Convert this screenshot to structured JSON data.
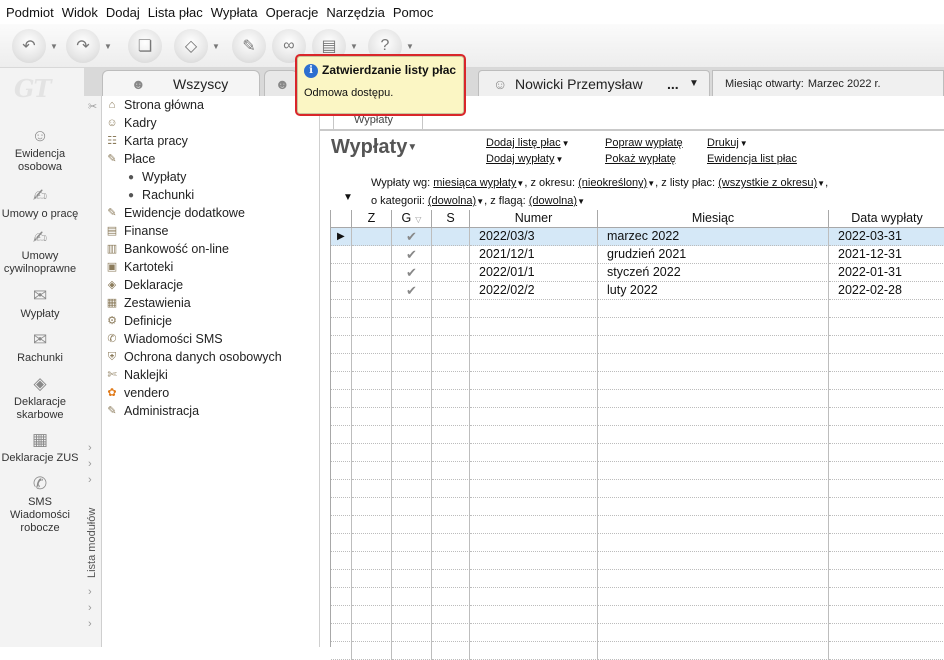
{
  "menu": [
    "Podmiot",
    "Widok",
    "Dodaj",
    "Lista płac",
    "Wypłata",
    "Operacje",
    "Narzędzia",
    "Pomoc"
  ],
  "toolbar": {
    "icons": [
      "back-icon",
      "forward-icon",
      "pages-icon",
      "eraser-icon",
      "tools-icon",
      "link-icon",
      "print-icon",
      "help-icon"
    ]
  },
  "logo": "GT",
  "modules": [
    {
      "label": "Ewidencja osobowa",
      "icon": "people-icon"
    },
    {
      "label": "Umowy o pracę",
      "icon": "contract-icon"
    },
    {
      "label": "Umowy cywilnoprawne",
      "icon": "civil-contract-icon"
    },
    {
      "label": "Wypłaty",
      "icon": "payouts-icon"
    },
    {
      "label": "Rachunki",
      "icon": "bills-icon"
    },
    {
      "label": "Deklaracje skarbowe",
      "icon": "tax-declaration-icon"
    },
    {
      "label": "Deklaracje ZUS",
      "icon": "zus-icon"
    },
    {
      "label": "SMS Wiadomości robocze",
      "icon": "sms-icon"
    }
  ],
  "modules_label": "Lista modułów",
  "tabs": {
    "all": "Wszyscy",
    "user": "Nowicki Przemysław",
    "user_more": "...",
    "month_label": "Miesiąc otwarty:",
    "month_value": "Marzec 2022 r."
  },
  "nav": [
    {
      "label": "Strona główna",
      "icon": "home-icon"
    },
    {
      "label": "Kadry",
      "icon": "staff-icon"
    },
    {
      "label": "Karta pracy",
      "icon": "workcard-icon"
    },
    {
      "label": "Płace",
      "icon": "payroll-icon"
    },
    {
      "label": "Ewidencje dodatkowe",
      "icon": "records-icon"
    },
    {
      "label": "Finanse",
      "icon": "finance-icon"
    },
    {
      "label": "Bankowość on-line",
      "icon": "bank-icon"
    },
    {
      "label": "Kartoteki",
      "icon": "files-icon"
    },
    {
      "label": "Deklaracje",
      "icon": "declaration-icon"
    },
    {
      "label": "Zestawienia",
      "icon": "report-icon"
    },
    {
      "label": "Definicje",
      "icon": "definition-icon"
    },
    {
      "label": "Wiadomości SMS",
      "icon": "sms-icon"
    },
    {
      "label": "Ochrona danych osobowych",
      "icon": "shield-icon"
    },
    {
      "label": "Naklejki",
      "icon": "sticker-icon"
    },
    {
      "label": "vendero",
      "icon": "vendero-icon"
    },
    {
      "label": "Administracja",
      "icon": "admin-icon"
    }
  ],
  "nav_sub": [
    "Wypłaty",
    "Rachunki"
  ],
  "content": {
    "tab_label": "Wypłaty",
    "heading": "Wypłaty",
    "actions": {
      "add_list": "Dodaj listę płac",
      "add_payout": "Dodaj wypłaty",
      "fix_payout": "Popraw wypłatę",
      "show_payout": "Pokaż wypłatę",
      "print": "Drukuj",
      "payroll_register": "Ewidencja list płac"
    },
    "filters": {
      "by_label": "Wypłaty wg:",
      "by_value": "miesiąca wypłaty",
      "period_label": ", z okresu:",
      "period_value": "(nieokreślony)",
      "list_label": ", z listy płac:",
      "list_value": "(wszystkie z okresu)",
      "category_label": "o kategorii:",
      "category_value": "(dowolna)",
      "flag_label": ", z flagą:",
      "flag_value": "(dowolna)"
    }
  },
  "table": {
    "columns": [
      "Z",
      "G",
      "S",
      "Numer",
      "Miesiąc",
      "Data wypłaty"
    ],
    "rows": [
      {
        "z": "",
        "g": "✔",
        "s": "",
        "numer": "2022/03/3",
        "miesiac": "marzec 2022",
        "data": "2022-03-31",
        "selected": true
      },
      {
        "z": "",
        "g": "✔",
        "s": "",
        "numer": "2021/12/1",
        "miesiac": "grudzień 2021",
        "data": "2021-12-31"
      },
      {
        "z": "",
        "g": "✔",
        "s": "",
        "numer": "2022/01/1",
        "miesiac": "styczeń 2022",
        "data": "2022-01-31"
      },
      {
        "z": "",
        "g": "✔",
        "s": "",
        "numer": "2022/02/2",
        "miesiac": "luty 2022",
        "data": "2022-02-28"
      }
    ]
  },
  "popup": {
    "title": "Zatwierdzanie listy płac",
    "message": "Odmowa dostępu.",
    "border_color": "#d9262a"
  }
}
